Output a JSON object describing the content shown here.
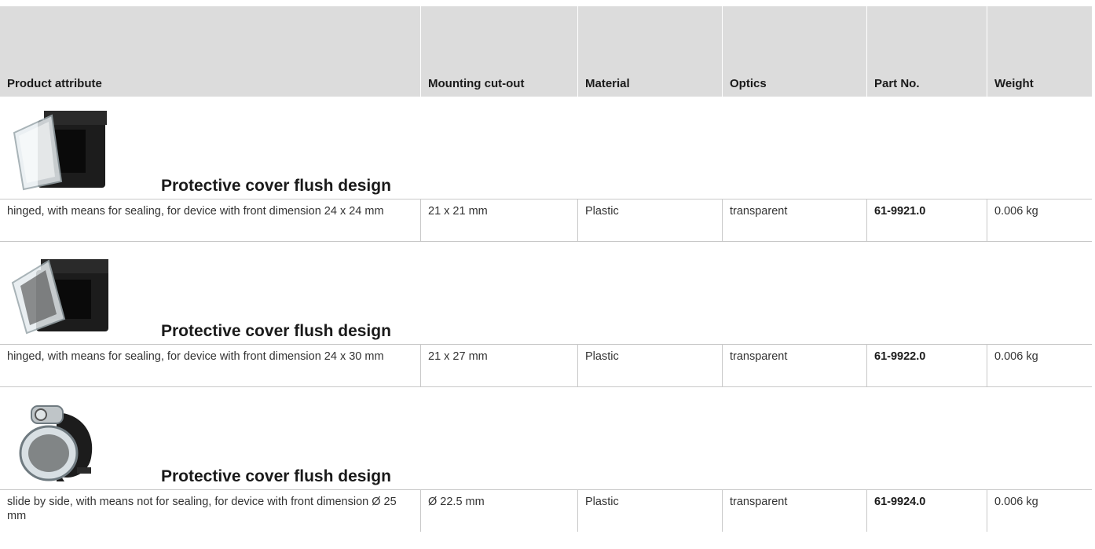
{
  "headers": [
    "Product attribute",
    "Mounting cut-out",
    "Material",
    "Optics",
    "Part No.",
    "Weight"
  ],
  "products": [
    {
      "title": "Protective cover flush design",
      "image_icon": "square-hinged-cover-24x24",
      "attribute": "hinged, with means for sealing, for device with front dimension 24 x 24 mm",
      "cutout": "21 x 21 mm",
      "material": "Plastic",
      "optics": "transparent",
      "part_no": "61-9921.0",
      "weight": "0.006 kg"
    },
    {
      "title": "Protective cover flush design",
      "image_icon": "rectangular-hinged-cover-24x30",
      "attribute": "hinged, with means for sealing, for device with front dimension 24 x 30 mm",
      "cutout": "21 x 27 mm",
      "material": "Plastic",
      "optics": "transparent",
      "part_no": "61-9922.0",
      "weight": "0.006 kg"
    },
    {
      "title": "Protective cover flush design",
      "image_icon": "round-slide-cover-25",
      "attribute": "slide by side, with means not for sealing, for device with front dimension Ø 25 mm",
      "cutout": "Ø 22.5 mm",
      "material": "Plastic",
      "optics": "transparent",
      "part_no": "61-9924.0",
      "weight": "0.006 kg"
    }
  ],
  "colors": {
    "header_bg": "#dcdcdc",
    "rule": "#c8c8c8"
  }
}
